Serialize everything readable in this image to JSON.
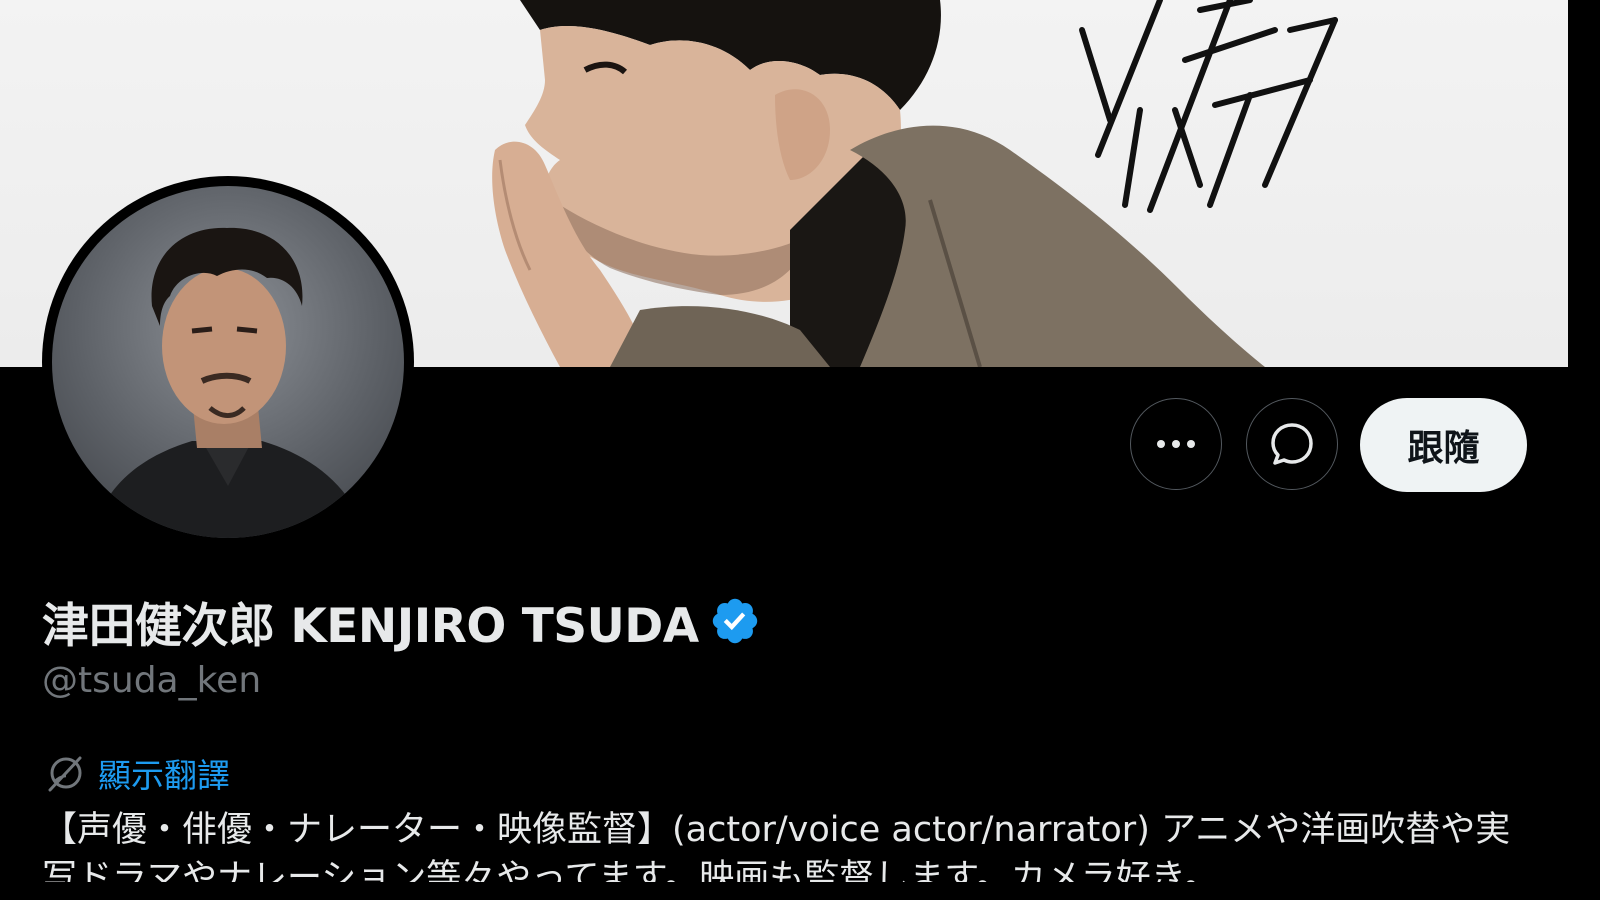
{
  "profile": {
    "display_name": "津田健次郎 KENJIRO TSUDA",
    "handle": "@tsuda_ken",
    "verified": true
  },
  "actions": {
    "more_icon": "more-horizontal-icon",
    "message_icon": "message-bubble-icon",
    "follow_label": "跟隨"
  },
  "translate": {
    "icon": "globe-translate-icon",
    "label": "顯示翻譯"
  },
  "bio": {
    "text": "【声優・俳優・ナレーター・映像監督】(actor/voice actor/narrator) アニメや洋画吹替や実写ドラマやナレーション等々やってます。映画も監督します。カメラ好き。"
  },
  "colors": {
    "background": "#000000",
    "text_primary": "#e7e9ea",
    "text_secondary": "#71767b",
    "link": "#1d9bf0",
    "verified_badge": "#1d9bf0",
    "follow_button_bg": "#eff3f4",
    "button_border": "#53595f"
  }
}
